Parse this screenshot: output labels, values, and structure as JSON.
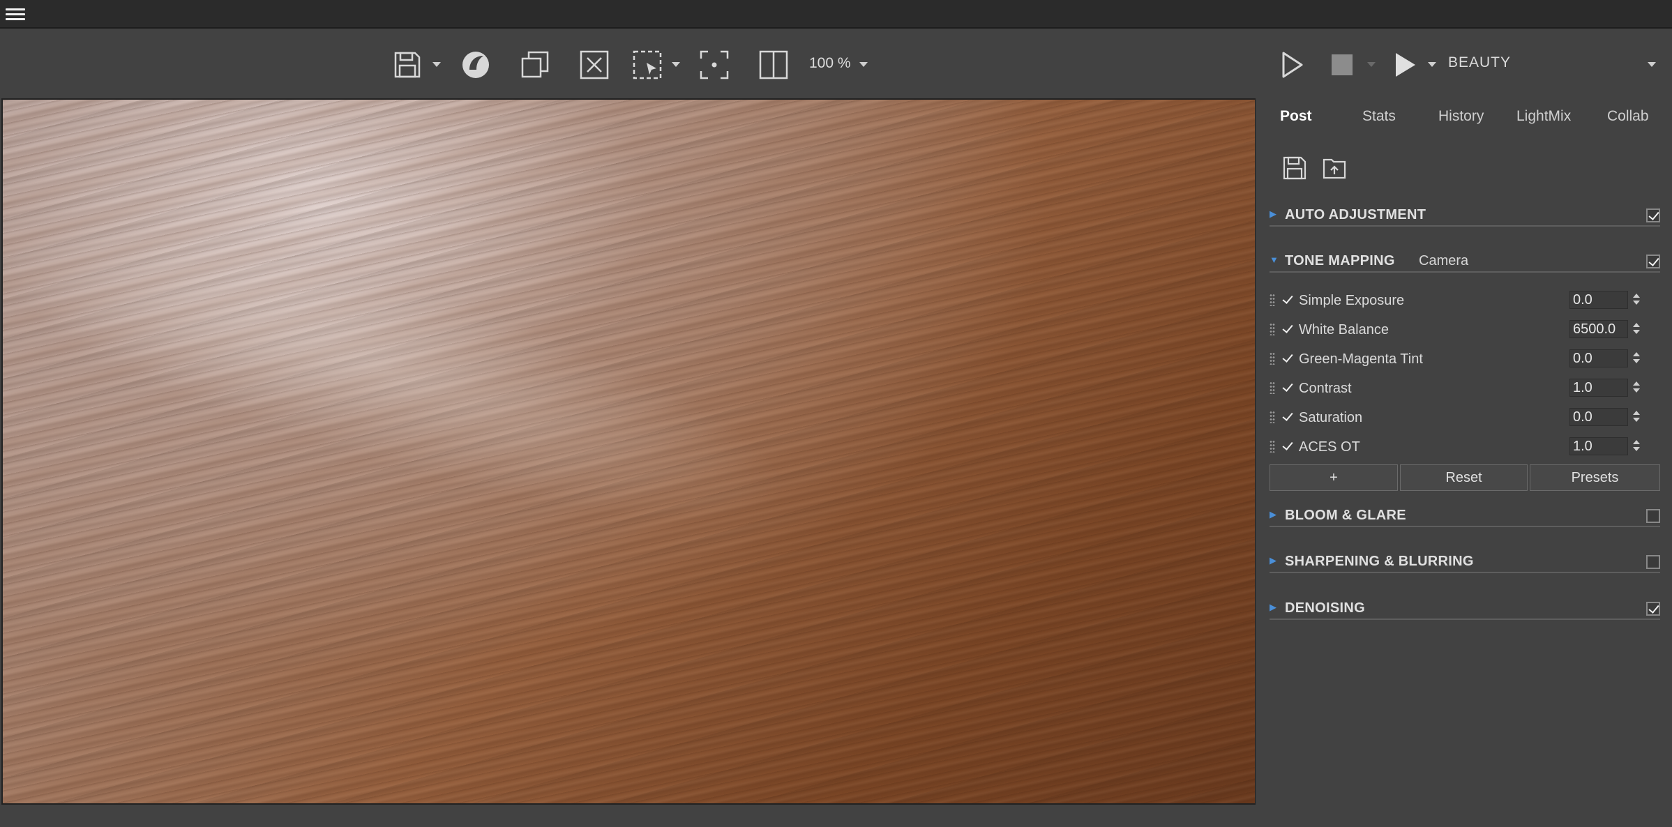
{
  "toolbar": {
    "zoom": "100 %",
    "render_element": "BEAUTY"
  },
  "tabs": [
    {
      "label": "Post"
    },
    {
      "label": "Stats"
    },
    {
      "label": "History"
    },
    {
      "label": "LightMix"
    },
    {
      "label": "Collab"
    }
  ],
  "sections": {
    "auto_adjustment": {
      "title": "AUTO ADJUSTMENT",
      "enabled": true
    },
    "tone_mapping": {
      "title": "TONE MAPPING",
      "subtitle": "Camera",
      "enabled": true
    },
    "bloom_glare": {
      "title": "BLOOM & GLARE",
      "enabled": false
    },
    "sharpening": {
      "title": "SHARPENING & BLURRING",
      "enabled": false
    },
    "denoising": {
      "title": "DENOISING",
      "enabled": true
    }
  },
  "tone_mapping_layers": [
    {
      "label": "Simple Exposure",
      "value": "0.0"
    },
    {
      "label": "White Balance",
      "value": "6500.0"
    },
    {
      "label": "Green-Magenta Tint",
      "value": "0.0"
    },
    {
      "label": "Contrast",
      "value": "1.0"
    },
    {
      "label": "Saturation",
      "value": "0.0"
    },
    {
      "label": "ACES OT",
      "value": "1.0"
    }
  ],
  "buttons": {
    "add": "+",
    "reset": "Reset",
    "presets": "Presets"
  },
  "colors": {
    "accent_arrow": "#4a8fd8",
    "panel_bg": "#424242",
    "topbar_bg": "#2b2b2b"
  }
}
